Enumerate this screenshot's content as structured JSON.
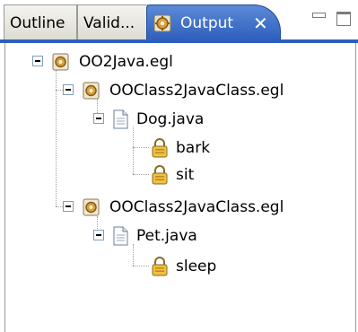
{
  "tabs": [
    {
      "label": "Outline",
      "active": false
    },
    {
      "label": "Valid...",
      "active": false
    },
    {
      "label": "Output",
      "active": true
    }
  ],
  "tab_close_glyph": "✕",
  "window_controls": {
    "minimize": "minimize",
    "maximize": "maximize"
  },
  "tree": {
    "root": {
      "label": "OO2Java.egl",
      "icon": "gear-file-icon"
    },
    "groups": [
      {
        "label": "OOClass2JavaClass.egl",
        "icon": "gear-file-icon",
        "file": {
          "label": "Dog.java",
          "icon": "document-icon",
          "methods": [
            {
              "label": "bark",
              "icon": "lock-icon"
            },
            {
              "label": "sit",
              "icon": "lock-icon"
            }
          ]
        }
      },
      {
        "label": "OOClass2JavaClass.egl",
        "icon": "gear-file-icon",
        "file": {
          "label": "Pet.java",
          "icon": "document-icon",
          "methods": [
            {
              "label": "sleep",
              "icon": "lock-icon"
            }
          ]
        }
      }
    ]
  },
  "colors": {
    "active_tab": "#3a6ac8",
    "tree_line": "#a0a0a0",
    "gear": "#c58a2a"
  }
}
